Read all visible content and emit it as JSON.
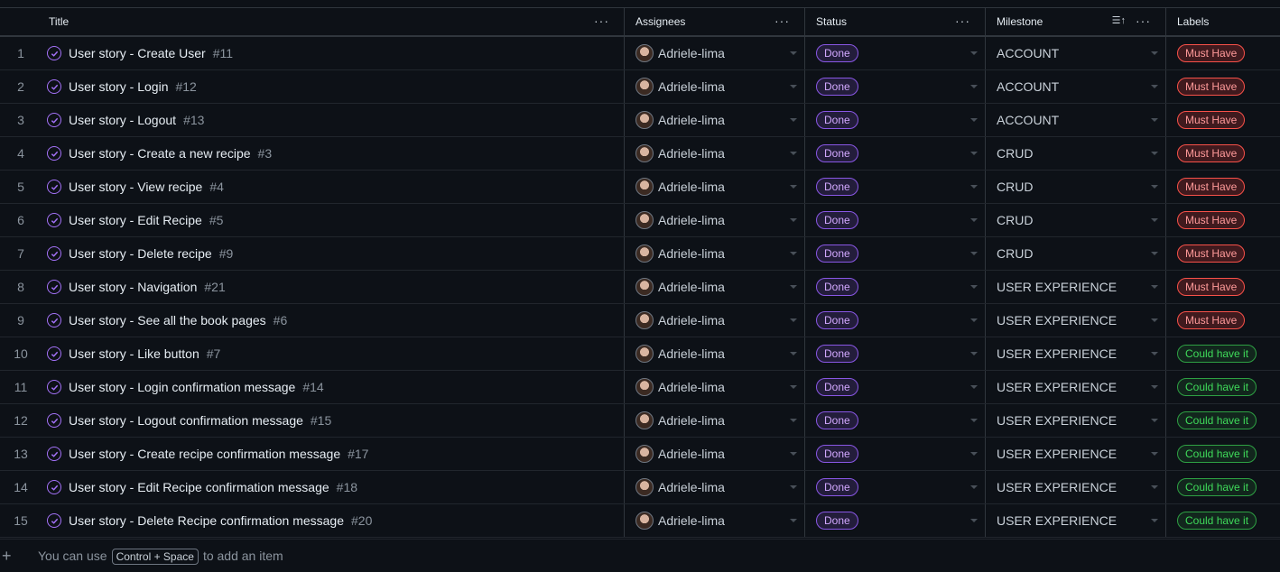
{
  "columns": {
    "title": "Title",
    "assignees": "Assignees",
    "status": "Status",
    "milestone": "Milestone",
    "labels": "Labels"
  },
  "colors": {
    "done_accent": "#a371f7",
    "must_have": "#f85149",
    "could_have": "#2ea043"
  },
  "rows": [
    {
      "n": "1",
      "title": "User story - Create User",
      "num": "#11",
      "assignee": "Adriele-lima",
      "status": "Done",
      "milestone": "ACCOUNT",
      "label": "Must Have",
      "label_kind": "must"
    },
    {
      "n": "2",
      "title": "User story - Login",
      "num": "#12",
      "assignee": "Adriele-lima",
      "status": "Done",
      "milestone": "ACCOUNT",
      "label": "Must Have",
      "label_kind": "must"
    },
    {
      "n": "3",
      "title": "User story - Logout",
      "num": "#13",
      "assignee": "Adriele-lima",
      "status": "Done",
      "milestone": "ACCOUNT",
      "label": "Must Have",
      "label_kind": "must"
    },
    {
      "n": "4",
      "title": "User story - Create a new recipe",
      "num": "#3",
      "assignee": "Adriele-lima",
      "status": "Done",
      "milestone": "CRUD",
      "label": "Must Have",
      "label_kind": "must"
    },
    {
      "n": "5",
      "title": "User story - View recipe",
      "num": "#4",
      "assignee": "Adriele-lima",
      "status": "Done",
      "milestone": "CRUD",
      "label": "Must Have",
      "label_kind": "must"
    },
    {
      "n": "6",
      "title": "User story - Edit Recipe",
      "num": "#5",
      "assignee": "Adriele-lima",
      "status": "Done",
      "milestone": "CRUD",
      "label": "Must Have",
      "label_kind": "must"
    },
    {
      "n": "7",
      "title": "User story - Delete recipe",
      "num": "#9",
      "assignee": "Adriele-lima",
      "status": "Done",
      "milestone": "CRUD",
      "label": "Must Have",
      "label_kind": "must"
    },
    {
      "n": "8",
      "title": "User story - Navigation",
      "num": "#21",
      "assignee": "Adriele-lima",
      "status": "Done",
      "milestone": "USER EXPERIENCE",
      "label": "Must Have",
      "label_kind": "must"
    },
    {
      "n": "9",
      "title": "User story - See all the book pages",
      "num": "#6",
      "assignee": "Adriele-lima",
      "status": "Done",
      "milestone": "USER EXPERIENCE",
      "label": "Must Have",
      "label_kind": "must"
    },
    {
      "n": "10",
      "title": "User story - Like button",
      "num": "#7",
      "assignee": "Adriele-lima",
      "status": "Done",
      "milestone": "USER EXPERIENCE",
      "label": "Could have it",
      "label_kind": "could"
    },
    {
      "n": "11",
      "title": "User story - Login confirmation message",
      "num": "#14",
      "assignee": "Adriele-lima",
      "status": "Done",
      "milestone": "USER EXPERIENCE",
      "label": "Could have it",
      "label_kind": "could"
    },
    {
      "n": "12",
      "title": "User story - Logout confirmation message",
      "num": "#15",
      "assignee": "Adriele-lima",
      "status": "Done",
      "milestone": "USER EXPERIENCE",
      "label": "Could have it",
      "label_kind": "could"
    },
    {
      "n": "13",
      "title": "User story - Create recipe confirmation message",
      "num": "#17",
      "assignee": "Adriele-lima",
      "status": "Done",
      "milestone": "USER EXPERIENCE",
      "label": "Could have it",
      "label_kind": "could"
    },
    {
      "n": "14",
      "title": "User story - Edit Recipe confirmation message",
      "num": "#18",
      "assignee": "Adriele-lima",
      "status": "Done",
      "milestone": "USER EXPERIENCE",
      "label": "Could have it",
      "label_kind": "could"
    },
    {
      "n": "15",
      "title": "User story - Delete Recipe confirmation message",
      "num": "#20",
      "assignee": "Adriele-lima",
      "status": "Done",
      "milestone": "USER EXPERIENCE",
      "label": "Could have it",
      "label_kind": "could"
    }
  ],
  "footer": {
    "before": "You can use",
    "shortcut": "Control + Space",
    "after": "to add an item"
  }
}
